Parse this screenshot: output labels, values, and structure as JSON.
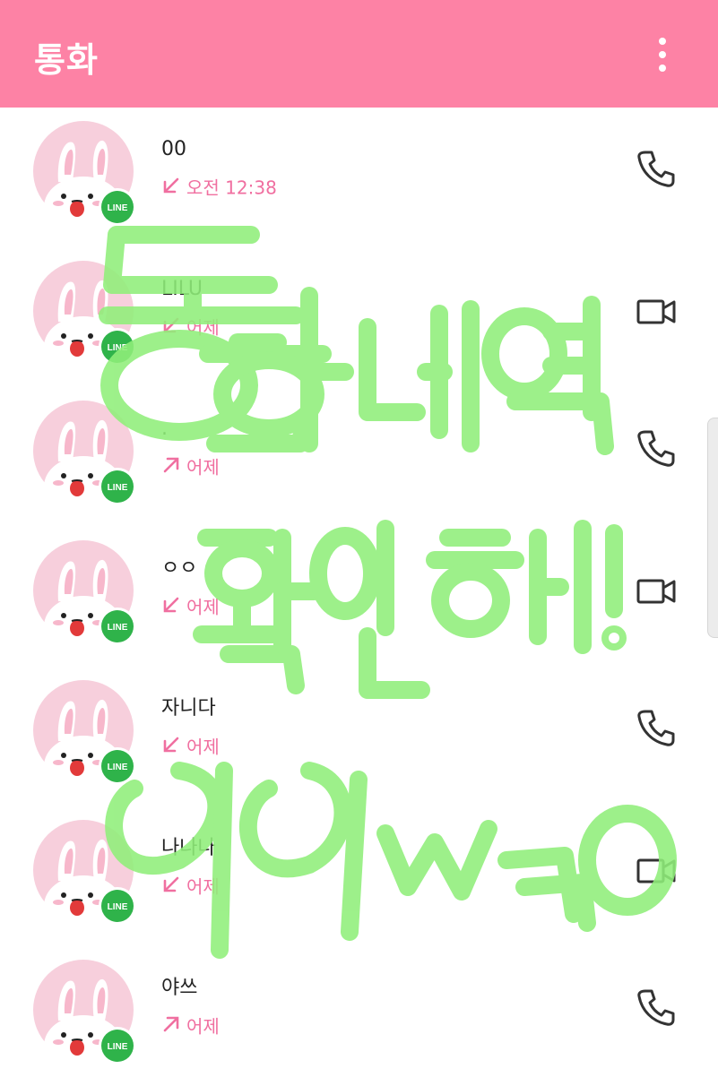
{
  "app_bar": {
    "title": "통화",
    "menu_icon": "more-vert-icon"
  },
  "colors": {
    "header_bg": "#fd82a5",
    "accent_pink": "#f06fa0",
    "line_badge_green": "#2fb34a",
    "overlay_green": "#90ef7a"
  },
  "calls": [
    {
      "name": "00",
      "direction": "incoming",
      "time": "오전 12:38",
      "action": "voice-call"
    },
    {
      "name": "LILU",
      "direction": "incoming",
      "time": "어제",
      "action": "video-call"
    },
    {
      "name": ".",
      "direction": "outgoing",
      "time": "어제",
      "action": "voice-call"
    },
    {
      "name": "ㅇㅇ",
      "direction": "incoming",
      "time": "어제",
      "action": "video-call"
    },
    {
      "name": "자니다",
      "direction": "incoming",
      "time": "어제",
      "action": "voice-call"
    },
    {
      "name": "나나나",
      "direction": "incoming",
      "time": "어제",
      "action": "video-call"
    },
    {
      "name": "야쓰",
      "direction": "outgoing",
      "time": "어제",
      "action": "voice-call"
    }
  ],
  "badge_text": "LINE",
  "handwritten_overlay": "통화내역 확인해! ㅋㅋwㄲㅇ"
}
